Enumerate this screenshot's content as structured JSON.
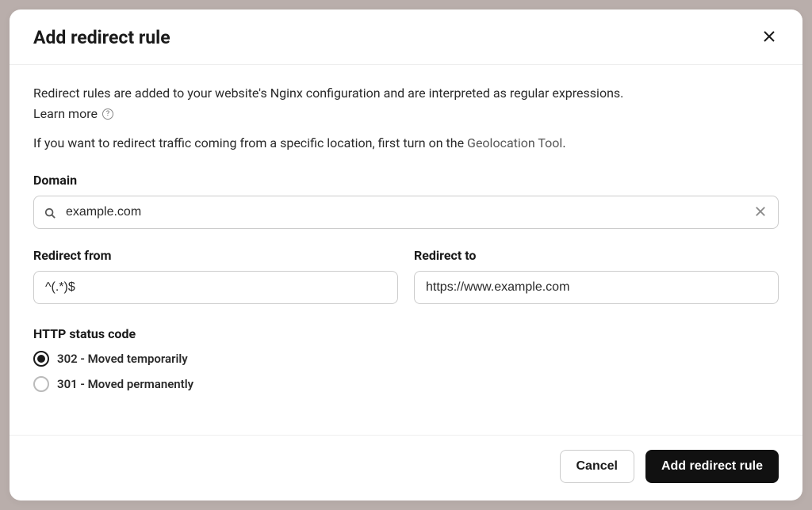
{
  "modal": {
    "title": "Add redirect rule",
    "description": "Redirect rules are added to your website's Nginx configuration and are interpreted as regular expressions.",
    "learn_more": "Learn more",
    "geolocation_prefix": "If you want to redirect traffic coming from a specific location, first turn on the ",
    "geolocation_link": "Geolocation Tool",
    "geolocation_suffix": "."
  },
  "form": {
    "domain_label": "Domain",
    "domain_value": "example.com",
    "redirect_from_label": "Redirect from",
    "redirect_from_value": "^(.*)$",
    "redirect_to_label": "Redirect to",
    "redirect_to_value": "https://www.example.com",
    "http_status_label": "HTTP status code",
    "radio_302": "302 - Moved temporarily",
    "radio_301": "301 - Moved permanently",
    "selected_status": "302"
  },
  "footer": {
    "cancel": "Cancel",
    "submit": "Add redirect rule"
  }
}
